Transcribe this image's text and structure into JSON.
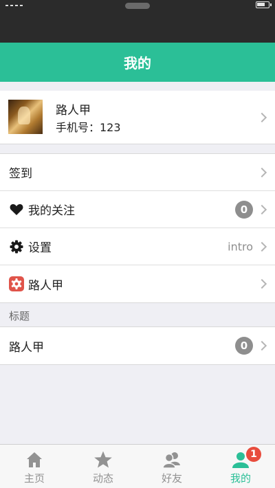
{
  "header": {
    "title": "我的"
  },
  "status": {
    "battery_level": 0.7
  },
  "profile": {
    "name": "路人甲",
    "phone": "手机号：123"
  },
  "group1": [
    {
      "label": "签到",
      "icon": null,
      "accessory": null
    },
    {
      "label": "我的关注",
      "icon": "heart-icon",
      "badge": "0"
    },
    {
      "label": "设置",
      "icon": "gear-icon",
      "detail": "intro"
    },
    {
      "label": "路人甲",
      "icon": "app-icon"
    }
  ],
  "section": {
    "title": "标题"
  },
  "group2": [
    {
      "label": "路人甲",
      "badge": "0"
    }
  ],
  "tabbar": {
    "items": [
      {
        "label": "主页",
        "icon": "home-icon"
      },
      {
        "label": "动态",
        "icon": "star-icon"
      },
      {
        "label": "好友",
        "icon": "friends-icon"
      },
      {
        "label": "我的",
        "icon": "person-icon",
        "badge": "1",
        "active": true
      }
    ]
  },
  "colors": {
    "accent": "#2bbf97",
    "badge_red": "#e84c3d",
    "badge_gray": "#8e8e8e"
  }
}
